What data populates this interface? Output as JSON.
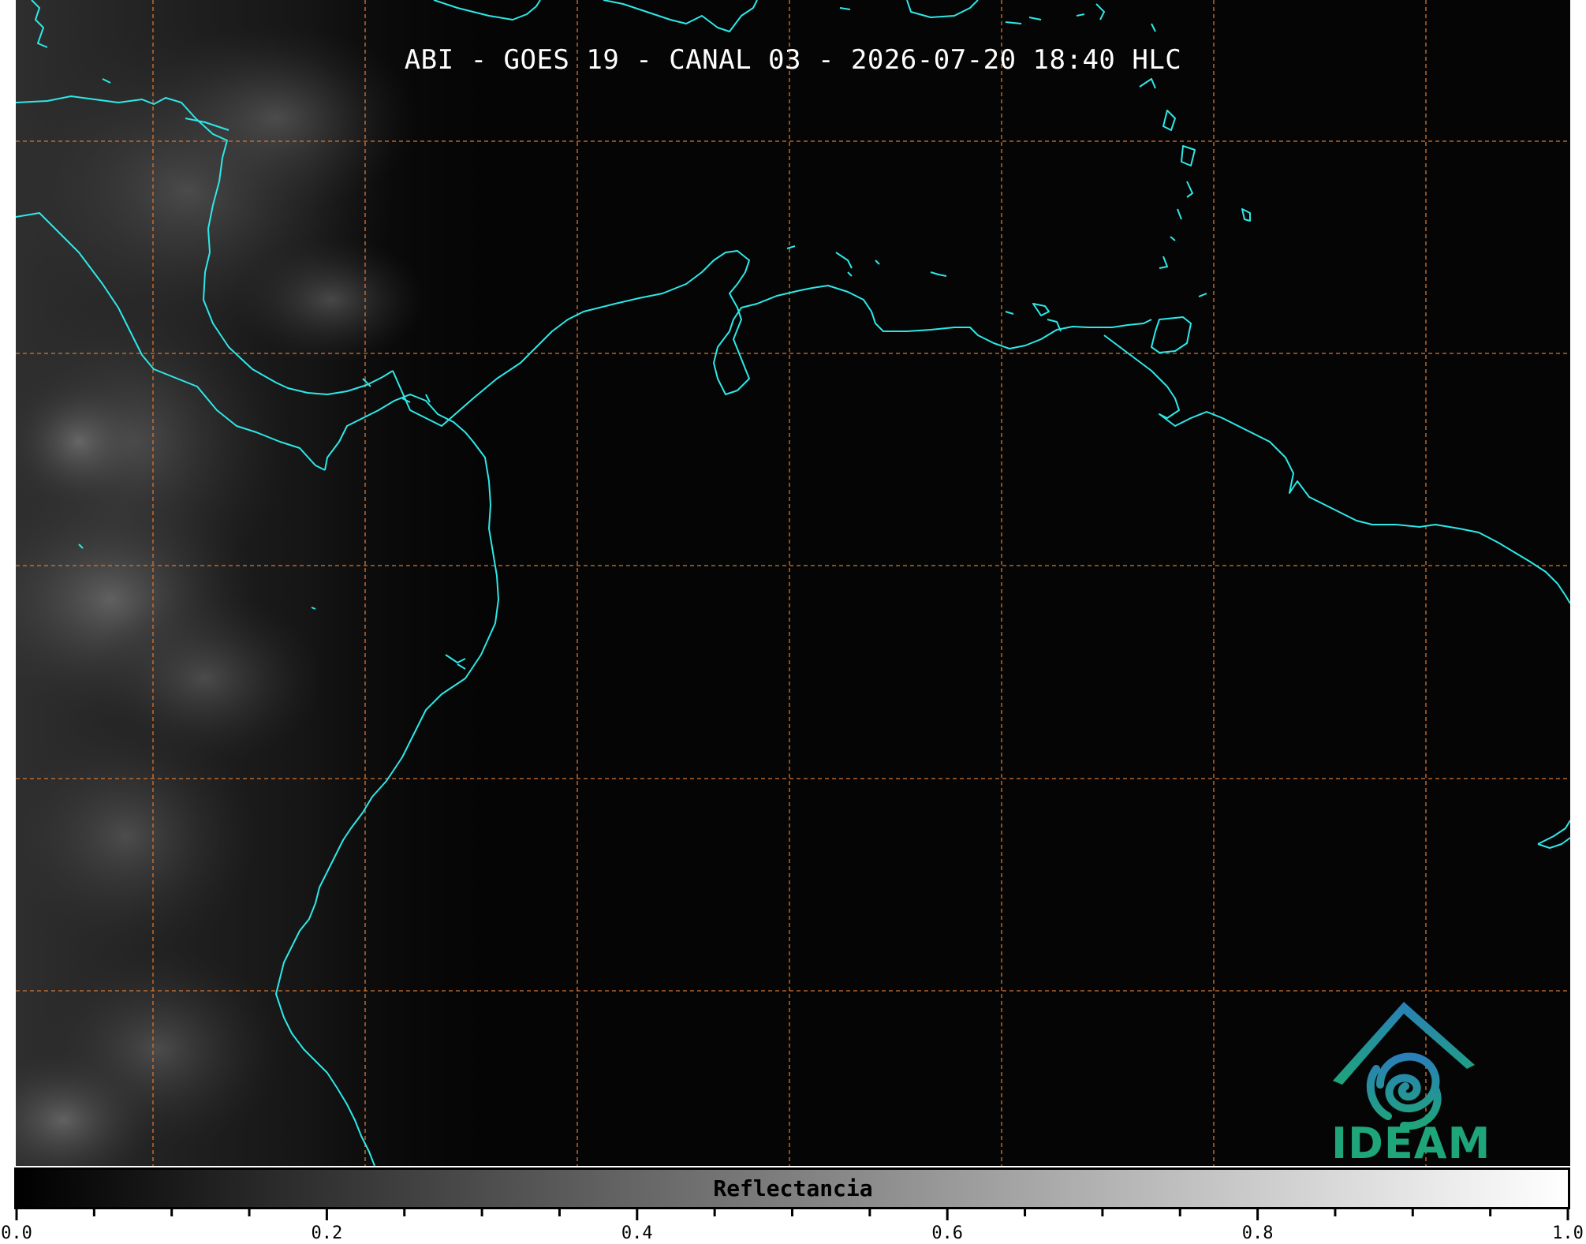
{
  "title": "ABI - GOES 19 - CANAL 03 - 2026-07-20 18:40 HLC",
  "colors": {
    "coastline": "#2ee8e8",
    "grid": "#d9762e",
    "background": "#050505",
    "logo_green": "#1ea57a",
    "logo_blue": "#2b7fb8"
  },
  "logo": {
    "text": "IDEAM",
    "icon": "ideam-mountain-spiral-logo"
  },
  "colorbar": {
    "label": "Reflectancia",
    "range": [
      0.0,
      1.0
    ],
    "gradient": [
      "#000000",
      "#ffffff"
    ],
    "major_ticks": [
      "0.0",
      "0.2",
      "0.4",
      "0.6",
      "0.8",
      "1.0"
    ],
    "minor_tick_step": 0.05
  },
  "map": {
    "grid": "dashed graticule",
    "coastlines": true,
    "cloud_cover": "bright clouds over Central America and Pacific (west side)"
  }
}
